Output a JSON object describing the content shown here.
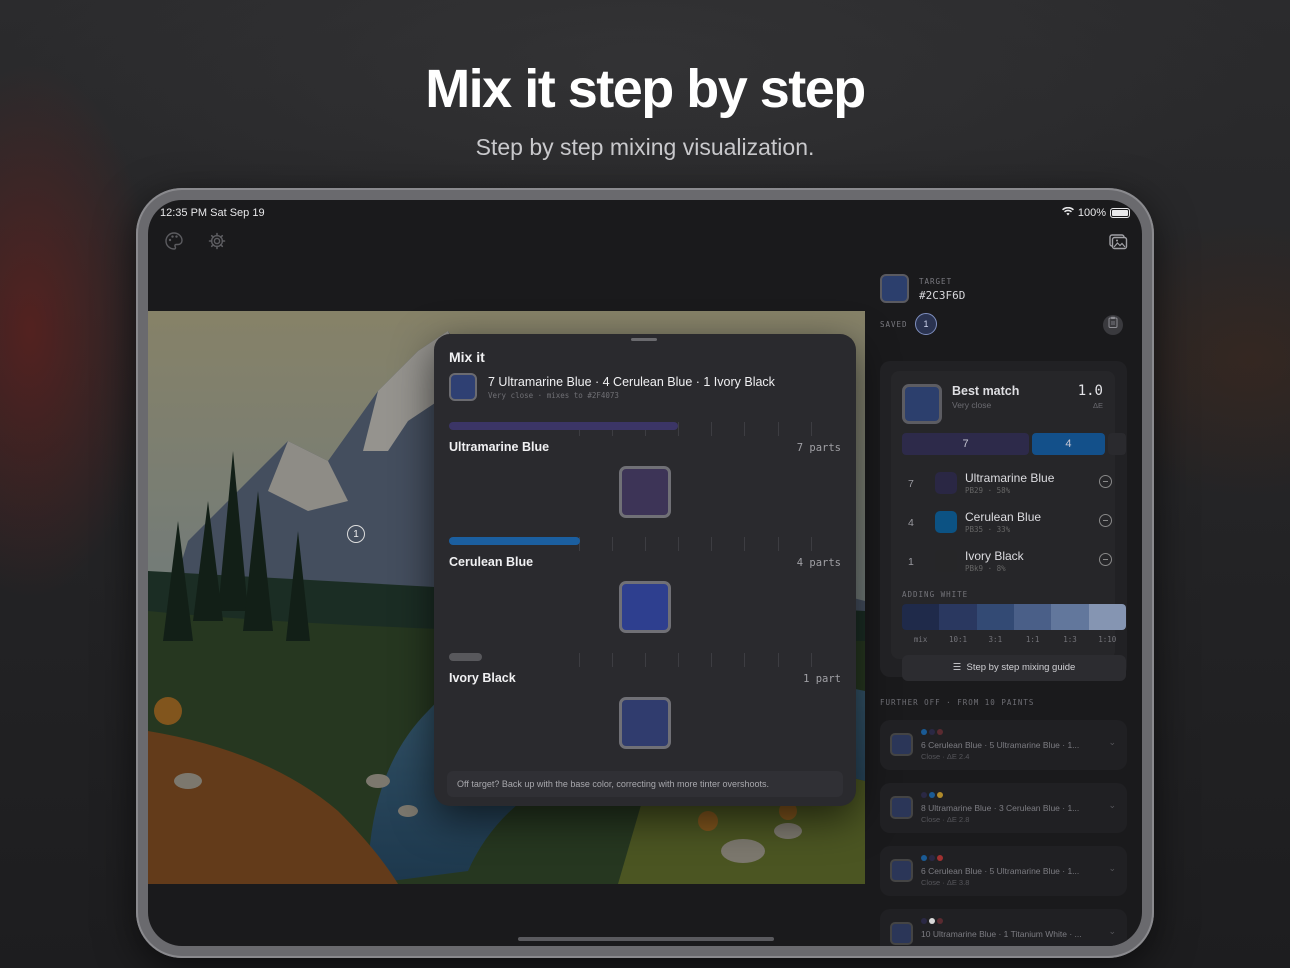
{
  "marketing": {
    "headline": "Mix it step by step",
    "subhead": "Step by step mixing visualization."
  },
  "status": {
    "time": "12:35 PM  Sat Sep 19",
    "battery": "100%"
  },
  "toolbar": {
    "palette_icon": "palette-icon",
    "settings_icon": "gear-icon",
    "photo_icon": "photo-library-icon"
  },
  "canvas": {
    "pin_label": "1"
  },
  "mix_sheet": {
    "title": "Mix it",
    "recipe": "7 Ultramarine Blue · 4 Cerulean Blue · 1 Ivory Black",
    "recipe_sub": "Very close · mixes to #2F4073",
    "steps": [
      {
        "name": "Ultramarine Blue",
        "parts": "7 parts",
        "bar_color": "#3b3566",
        "swatch_color": "#3D3457",
        "fraction": 0.583
      },
      {
        "name": "Cerulean Blue",
        "parts": "4 parts",
        "bar_color": "#1b5fa0",
        "swatch_color": "#2E3F8F",
        "fraction": 0.333
      },
      {
        "name": "Ivory Black",
        "parts": "1 part",
        "bar_color": "#58585c",
        "swatch_color": "#303C6E",
        "fraction": 0.083
      }
    ],
    "tip": "Off target? Back up with the base color, correcting with more tinter overshoots."
  },
  "panel": {
    "target_label": "TARGET",
    "target_hex": "#2C3F6D",
    "saved_label": "SAVED",
    "saved_count": "1",
    "best_match": {
      "title": "Best match",
      "subtitle": "Very close",
      "delta": "1.0",
      "delta_label": "ΔE",
      "ratio": [
        {
          "label": "7",
          "color": "#2d2a4a",
          "fraction": 0.583
        },
        {
          "label": "4",
          "color": "#13508a",
          "fraction": 0.333
        },
        {
          "label": "",
          "color": "#2a2a2e",
          "fraction": 0.083
        }
      ],
      "ingredients": [
        {
          "count": "7",
          "name": "Ultramarine Blue",
          "sub": "PB29 · 58%",
          "color": "#2a2744"
        },
        {
          "count": "4",
          "name": "Cerulean Blue",
          "sub": "PB35 · 33%",
          "color": "#0c5283"
        },
        {
          "count": "1",
          "name": "Ivory Black",
          "sub": "PBk9 · 8%",
          "color": "#262628"
        }
      ],
      "adding_white_label": "ADDING WHITE",
      "white_steps": [
        "#1f2a4a",
        "#2a3860",
        "#334a74",
        "#4a5f88",
        "#62779c",
        "#8595b2"
      ],
      "white_ticks": [
        "mix",
        "10:1",
        "3:1",
        "1:1",
        "1:3",
        "1:10"
      ],
      "guide_button": "Step by step mixing guide"
    },
    "further_label": "FURTHER OFF · FROM 10 PAINTS",
    "alternatives": [
      {
        "text": "6 Cerulean Blue · 5 Ultramarine Blue · 1...",
        "sub": "Close · ΔE 2.4",
        "dots": [
          "#1a5a94",
          "#2a2844",
          "#5a2a30"
        ]
      },
      {
        "text": "8 Ultramarine Blue · 3 Cerulean Blue · 1...",
        "sub": "Close · ΔE 2.8",
        "dots": [
          "#2a2844",
          "#1a5a94",
          "#b08a2a"
        ]
      },
      {
        "text": "6 Cerulean Blue · 5 Ultramarine Blue · 1...",
        "sub": "Close · ΔE 3.8",
        "dots": [
          "#1a5a94",
          "#2a2844",
          "#a03030"
        ]
      },
      {
        "text": "10 Ultramarine Blue · 1 Titanium White · ...",
        "sub": "",
        "dots": [
          "#2a2844",
          "#d8d8d8",
          "#5a2a30"
        ]
      }
    ]
  }
}
